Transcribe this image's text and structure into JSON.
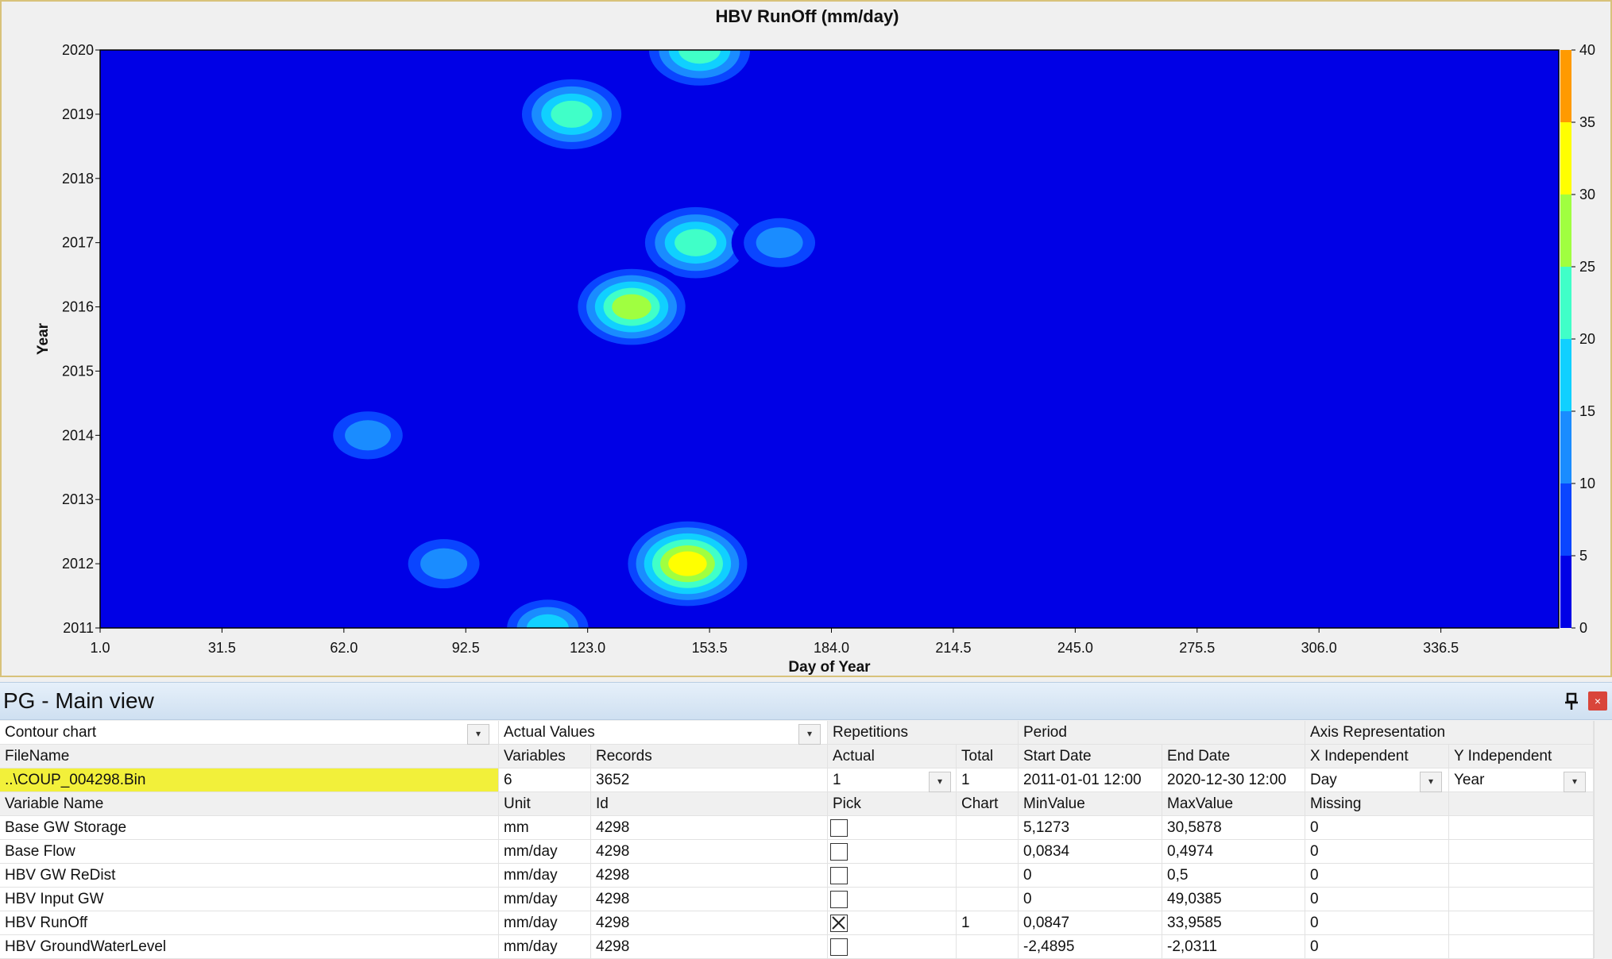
{
  "chart": {
    "title": "HBV RunOff (mm/day)",
    "xlabel": "Day of Year",
    "ylabel": "Year",
    "x_ticks": [
      "1.0",
      "31.5",
      "62.0",
      "92.5",
      "123.0",
      "153.5",
      "184.0",
      "214.5",
      "245.0",
      "275.5",
      "306.0",
      "336.5"
    ],
    "y_ticks": [
      "2011",
      "2012",
      "2013",
      "2014",
      "2015",
      "2016",
      "2017",
      "2018",
      "2019",
      "2020"
    ],
    "colorbar_ticks": [
      "0",
      "5",
      "10",
      "15",
      "20",
      "25",
      "30",
      "35",
      "40"
    ],
    "colorbar_colors": [
      "#0000e6",
      "#0a45ff",
      "#1a8cff",
      "#10d0ff",
      "#40ffc8",
      "#a0ff40",
      "#ffff00",
      "#ff9a00",
      "#ff0000"
    ]
  },
  "chart_data": {
    "type": "heatmap",
    "title": "HBV RunOff (mm/day)",
    "xlabel": "Day of Year",
    "ylabel": "Year",
    "xlim": [
      1,
      366
    ],
    "ylim": [
      2011,
      2020
    ],
    "zlim": [
      0,
      40
    ],
    "hotspots": [
      {
        "day": 148,
        "year": 2012.0,
        "peak": 33
      },
      {
        "day": 150,
        "year": 2017.0,
        "peak": 25
      },
      {
        "day": 119,
        "year": 2019.0,
        "peak": 24
      },
      {
        "day": 134,
        "year": 2016.0,
        "peak": 27
      },
      {
        "day": 151,
        "year": 2020.0,
        "peak": 25
      },
      {
        "day": 87,
        "year": 2012.0,
        "peak": 14
      },
      {
        "day": 68,
        "year": 2014.0,
        "peak": 13
      },
      {
        "day": 113,
        "year": 2011.0,
        "peak": 16
      },
      {
        "day": 171,
        "year": 2017.0,
        "peak": 14
      }
    ]
  },
  "panel": {
    "title": "PG - Main view",
    "pin_icon": "pin-icon",
    "close_icon": "close-icon"
  },
  "grid": {
    "chart_type": "Contour chart",
    "value_type": "Actual Values",
    "repetitions_label": "Repetitions",
    "period_label": "Period",
    "axis_label": "Axis Representation",
    "header2": [
      "FileName",
      "Variables",
      "Records",
      "Actual",
      "Total",
      "Start Date",
      "End Date",
      "X Independent",
      "Y Independent"
    ],
    "file": {
      "name": "..\\COUP_004298.Bin",
      "variables": "6",
      "records": "3652",
      "actual": "1",
      "total": "1",
      "start": "2011-01-01 12:00",
      "end": "2020-12-30 12:00",
      "x_independent": "Day",
      "y_independent": "Year"
    },
    "header3": [
      "Variable Name",
      "Unit",
      "Id",
      "Pick",
      "Chart",
      "MinValue",
      "MaxValue",
      "Missing"
    ],
    "rows": [
      {
        "name": "Base GW Storage",
        "unit": "mm",
        "id": "4298",
        "pick": false,
        "chart": "",
        "min": "5,1273",
        "max": "30,5878",
        "missing": "0"
      },
      {
        "name": "Base Flow",
        "unit": "mm/day",
        "id": "4298",
        "pick": false,
        "chart": "",
        "min": "0,0834",
        "max": "0,4974",
        "missing": "0"
      },
      {
        "name": "HBV GW ReDist",
        "unit": "mm/day",
        "id": "4298",
        "pick": false,
        "chart": "",
        "min": "0",
        "max": "0,5",
        "missing": "0"
      },
      {
        "name": "HBV Input GW",
        "unit": "mm/day",
        "id": "4298",
        "pick": false,
        "chart": "",
        "min": "0",
        "max": "49,0385",
        "missing": "0"
      },
      {
        "name": "HBV RunOff",
        "unit": "mm/day",
        "id": "4298",
        "pick": true,
        "chart": "1",
        "min": "0,0847",
        "max": "33,9585",
        "missing": "0"
      },
      {
        "name": "HBV GroundWaterLevel",
        "unit": "mm/day",
        "id": "4298",
        "pick": false,
        "chart": "",
        "min": "-2,4895",
        "max": "-2,0311",
        "missing": "0"
      }
    ]
  }
}
